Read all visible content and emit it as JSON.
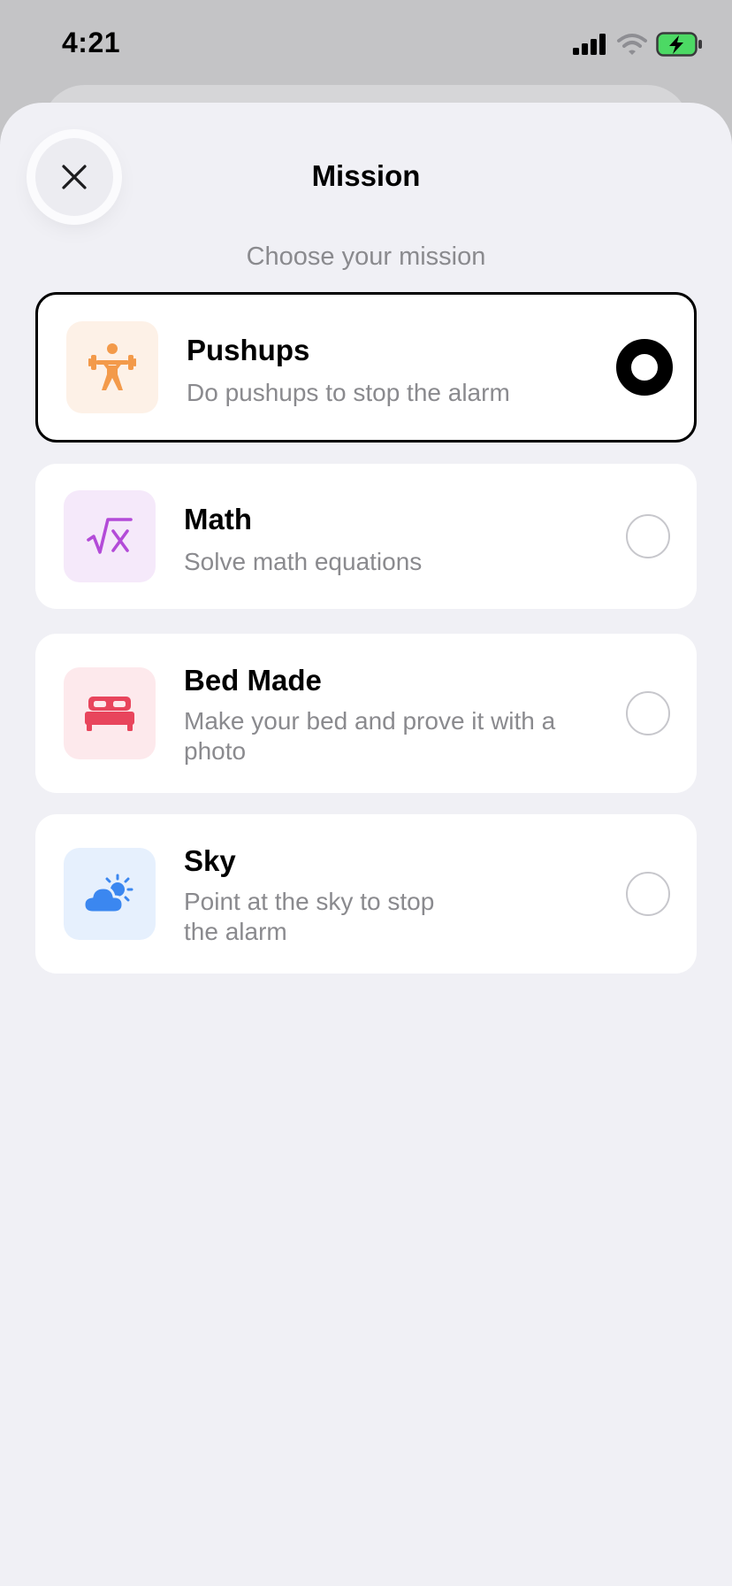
{
  "status_bar": {
    "time": "4:21"
  },
  "header": {
    "title": "Mission",
    "subtitle": "Choose your mission"
  },
  "colors": {
    "pushups_icon": "#f39a4a",
    "pushups_bg": "#fdf1e7",
    "math_icon": "#b34bd8",
    "math_bg": "#f5e9fa",
    "bed_icon": "#e8455c",
    "bed_bg": "#fde9ec",
    "sky_icon": "#3b87f0",
    "sky_bg": "#e6f0fd"
  },
  "missions": [
    {
      "title": "Pushups",
      "description": "Do pushups to stop the alarm",
      "icon": "weightlifter-icon",
      "selected": true
    },
    {
      "title": "Math",
      "description": "Solve math equations",
      "icon": "square-root-icon",
      "selected": false
    },
    {
      "title": "Bed Made",
      "description": "Make your bed and prove it with a photo",
      "icon": "bed-icon",
      "selected": false
    },
    {
      "title": "Sky",
      "description": "Point at the sky to stop the alarm",
      "icon": "cloud-sun-icon",
      "selected": false
    }
  ]
}
